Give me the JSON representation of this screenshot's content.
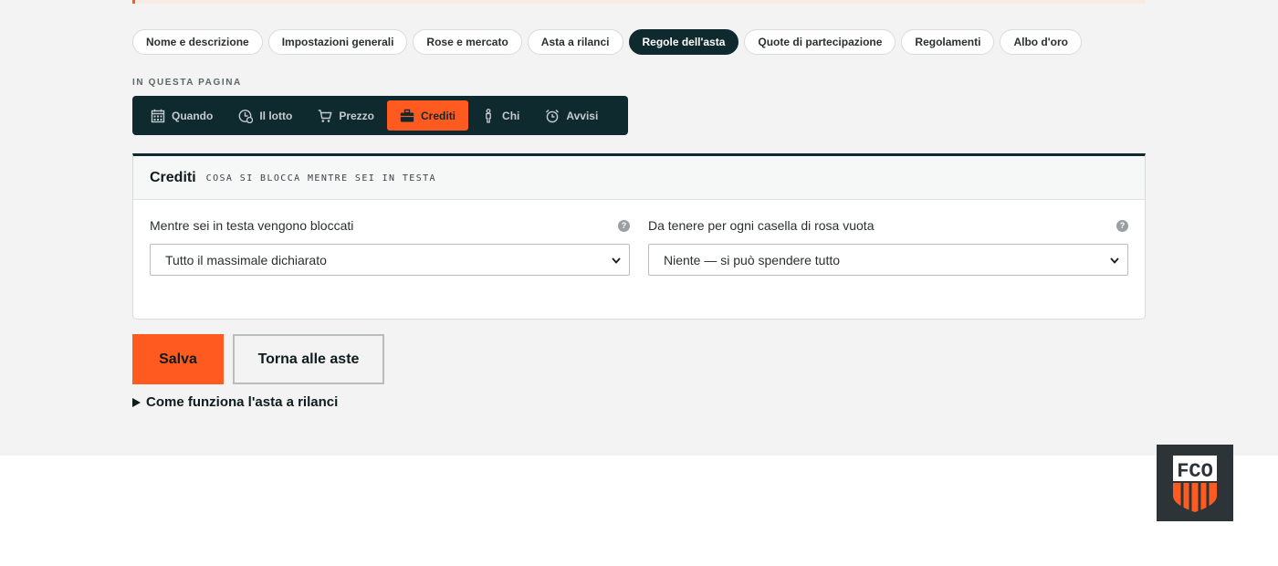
{
  "tabs": [
    {
      "label": "Nome e descrizione"
    },
    {
      "label": "Impostazioni generali"
    },
    {
      "label": "Rose e mercato"
    },
    {
      "label": "Asta a rilanci"
    },
    {
      "label": "Regole dell'asta"
    },
    {
      "label": "Quote di partecipazione"
    },
    {
      "label": "Regolamenti"
    },
    {
      "label": "Albo d'oro"
    }
  ],
  "active_tab": "Regole dell'asta",
  "page_nav": {
    "label": "IN QUESTA PAGINA",
    "items": [
      {
        "label": "Quando",
        "icon": "calendar-icon"
      },
      {
        "label": "Il lotto",
        "icon": "clock-pie-icon"
      },
      {
        "label": "Prezzo",
        "icon": "cart-icon"
      },
      {
        "label": "Crediti",
        "icon": "briefcase-icon"
      },
      {
        "label": "Chi",
        "icon": "person-icon"
      },
      {
        "label": "Avvisi",
        "icon": "alarm-icon"
      }
    ],
    "active": "Crediti"
  },
  "panel": {
    "title": "Crediti",
    "subtitle": "COSA SI BLOCCA MENTRE SEI IN TESTA",
    "fields": [
      {
        "label": "Mentre sei in testa vengono bloccati",
        "value": "Tutto il massimale dichiarato",
        "help": "?"
      },
      {
        "label": "Da tenere per ogni casella di rosa vuota",
        "value": "Niente — si può spendere tutto",
        "help": "?"
      }
    ]
  },
  "actions": {
    "save_label": "Salva",
    "back_label": "Torna alle aste"
  },
  "details_label": "Come funziona l'asta a rilanci",
  "logo": {
    "text": "FCO"
  },
  "colors": {
    "accent": "#ff5a1f",
    "dark": "#0f2a2e",
    "background": "#f2f3f2"
  }
}
